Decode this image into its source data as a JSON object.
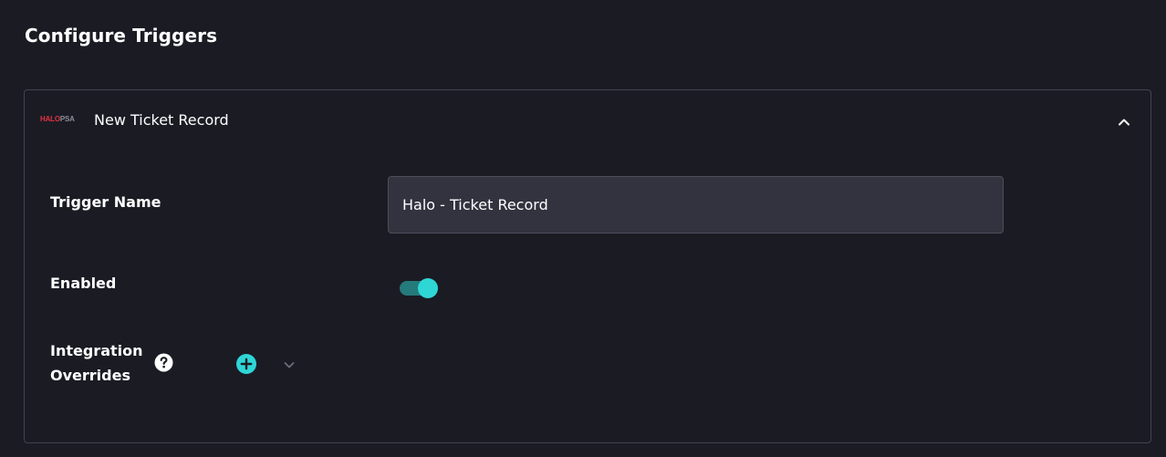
{
  "page": {
    "title": "Configure Triggers"
  },
  "trigger_card": {
    "logo": {
      "part1": "HALO",
      "part2": "PSA"
    },
    "title": "New Ticket Record",
    "collapse_icon": "chevron-up-icon",
    "fields": {
      "trigger_name": {
        "label": "Trigger Name",
        "value": "Halo - Ticket Record"
      },
      "enabled": {
        "label": "Enabled",
        "checked": true
      },
      "integration_overrides": {
        "label": "Integration Overrides",
        "help_icon": "question-circle-icon",
        "add_icon": "plus-circle-icon",
        "expand_icon": "chevron-down-icon"
      }
    }
  },
  "colors": {
    "background": "#1b1b24",
    "card_border": "#43434e",
    "input_background": "#33323f",
    "accent": "#2fd6d6",
    "toggle_track": "#257a7b",
    "logo_red": "#e0333f"
  }
}
